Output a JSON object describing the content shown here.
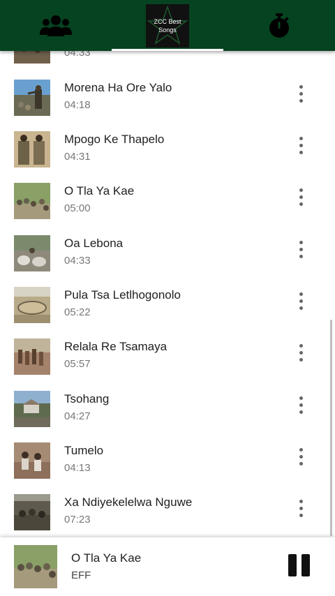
{
  "app": {
    "logo_line1": "ZCC Best",
    "logo_line2": "Songs",
    "tabs": [
      {
        "icon": "group-icon"
      },
      {
        "icon": "app-logo"
      },
      {
        "icon": "stopwatch-icon"
      }
    ],
    "selected_tab": 1
  },
  "songs": [
    {
      "title": "",
      "duration": "04:33"
    },
    {
      "title": "Morena Ha Ore Yalo",
      "duration": "04:18"
    },
    {
      "title": "Mpogo Ke Thapelo",
      "duration": "04:31"
    },
    {
      "title": "O Tla Ya Kae",
      "duration": "05:00"
    },
    {
      "title": "Oa Lebona",
      "duration": "04:33"
    },
    {
      "title": "Pula Tsa Letlhogonolo",
      "duration": "05:22"
    },
    {
      "title": "Relala Re Tsamaya",
      "duration": "05:57"
    },
    {
      "title": "Tsohang",
      "duration": "04:27"
    },
    {
      "title": "Tumelo",
      "duration": "04:13"
    },
    {
      "title": "Xa Ndiyekelelwa Nguwe",
      "duration": "07:23"
    }
  ],
  "now_playing": {
    "title": "O Tla Ya Kae",
    "artist": "EFF",
    "state_icon": "pause-icon"
  },
  "colors": {
    "appbar": "#064320",
    "indicator": "#ffffff"
  }
}
